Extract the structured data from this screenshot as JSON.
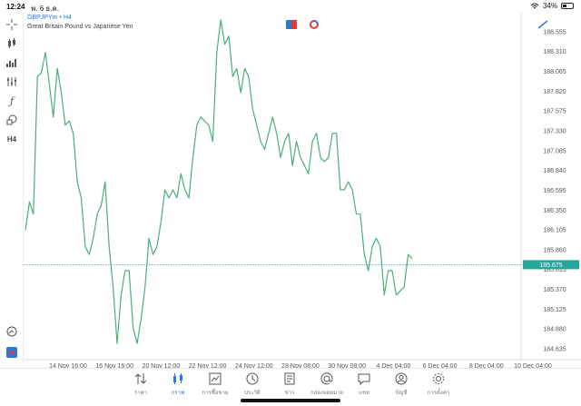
{
  "status": {
    "time": "12:24",
    "date": "พ. 6 ธ.ค.",
    "battery": "34%"
  },
  "header": {
    "symbol": "GBPJPYm",
    "timeframe": "H4",
    "description": "Great Britain Pound vs Japanese Yen"
  },
  "toolbar": {
    "items": [
      {
        "icon": "crosshair-icon"
      },
      {
        "icon": "candles-icon"
      },
      {
        "icon": "indicators-icon"
      },
      {
        "icon": "settings-sliders-icon"
      },
      {
        "icon": "function-icon"
      },
      {
        "icon": "shapes-icon"
      },
      {
        "label": "H4"
      },
      {
        "icon": "search-icon"
      },
      {
        "icon": "app-logo-icon"
      }
    ]
  },
  "chart_data": {
    "type": "line",
    "series": [
      {
        "values": [
          186.1,
          186.45,
          186.3,
          188.0,
          188.05,
          188.3,
          187.9,
          187.5,
          188.1,
          187.8,
          187.4,
          187.45,
          187.3,
          186.7,
          186.5,
          185.9,
          185.8,
          186.0,
          186.3,
          186.4,
          186.7,
          185.9,
          185.4,
          184.7,
          185.3,
          185.6,
          185.6,
          184.9,
          184.7,
          185.0,
          185.4,
          186.0,
          185.8,
          185.9,
          186.2,
          186.6,
          186.5,
          186.6,
          186.5,
          186.8,
          186.6,
          186.5,
          187.0,
          187.4,
          187.5,
          187.45,
          187.4,
          187.2,
          188.3,
          188.7,
          188.4,
          188.5,
          188.0,
          188.1,
          187.8,
          188.1,
          188.0,
          187.6,
          187.4,
          187.2,
          187.1,
          187.3,
          187.5,
          187.3,
          187.0,
          187.2,
          187.3,
          186.9,
          187.2,
          187.0,
          186.9,
          186.8,
          187.2,
          187.3,
          187.0,
          186.95,
          187.0,
          187.3,
          187.3,
          186.6,
          186.6,
          186.7,
          186.6,
          186.3,
          186.3,
          185.8,
          185.6,
          185.9,
          186.0,
          185.9,
          185.3,
          185.6,
          185.6,
          185.3,
          185.35,
          185.4,
          185.8,
          185.75
        ]
      }
    ],
    "y_ticks": [
      "188.555",
      "188.310",
      "188.065",
      "187.820",
      "187.575",
      "187.330",
      "187.085",
      "186.840",
      "186.595",
      "186.350",
      "186.105",
      "185.860",
      "185.615",
      "185.370",
      "185.125",
      "184.880",
      "184.635"
    ],
    "x_ticks": [
      "14 Nov 16:00",
      "16 Nov 16:00",
      "20 Nov 12:00",
      "22 Nov 12:00",
      "24 Nov 12:00",
      "28 Nov 08:00",
      "30 Nov 08:00",
      "4 Dec 04:00",
      "6 Dec 04:00",
      "8 Dec 04:00",
      "10 Dec 04:00"
    ],
    "current_price": "185.675",
    "ylim": [
      184.5,
      188.7
    ],
    "line_color": "#4caf7a",
    "price_line_color": "#26a69a"
  },
  "nav": {
    "items": [
      {
        "label": "ราคา",
        "icon": "quotes-icon"
      },
      {
        "label": "กราฟ",
        "icon": "chart-icon",
        "active": true
      },
      {
        "label": "การซื้อขาย",
        "icon": "trade-icon"
      },
      {
        "label": "ประวัติ",
        "icon": "history-icon"
      },
      {
        "label": "ข่าว",
        "icon": "news-icon"
      },
      {
        "label": "กล่องจดหมาย",
        "icon": "mail-icon"
      },
      {
        "label": "แชท",
        "icon": "chat-icon"
      },
      {
        "label": "บัญชี",
        "icon": "account-icon"
      },
      {
        "label": "การตั้งค่า",
        "icon": "settings-icon"
      }
    ]
  }
}
